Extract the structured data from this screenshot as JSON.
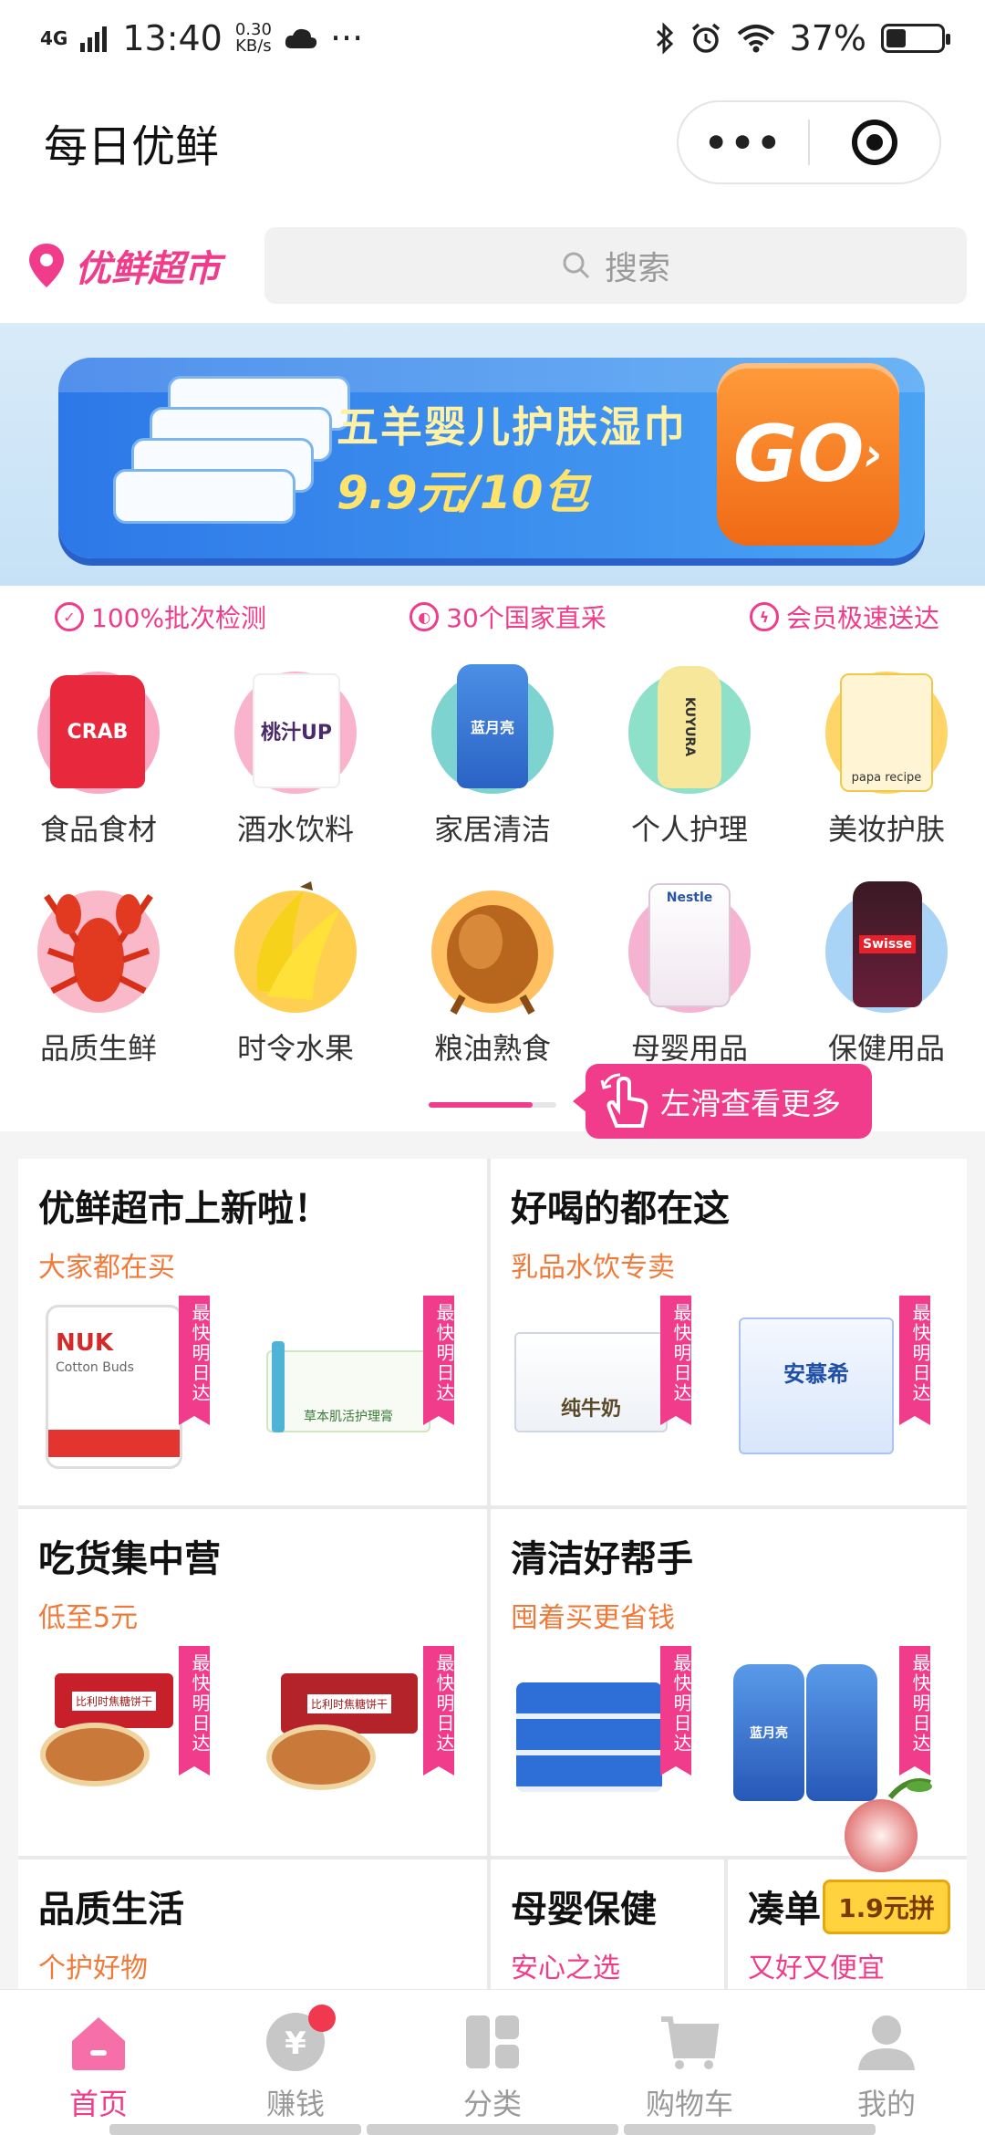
{
  "status_bar": {
    "network": "4G",
    "time": "13:40",
    "speed_value": "0.30",
    "speed_unit": "KB/s",
    "more": "···",
    "battery": "37%",
    "battery_level": 0.37
  },
  "title_bar": {
    "title": "每日优鲜",
    "more_label": "•••"
  },
  "search": {
    "store_name": "优鲜超市",
    "placeholder": "搜索"
  },
  "banner": {
    "headline": "五羊婴儿护肤湿巾",
    "price": "9.9元/10包",
    "go": "GO"
  },
  "features": [
    {
      "label": "100%批次检测",
      "icon": "shield-check-icon"
    },
    {
      "label": "30个国家直采",
      "icon": "globe-icon"
    },
    {
      "label": "会员极速送达",
      "icon": "lightning-icon"
    }
  ],
  "categories_row1": [
    {
      "label": "食品食材",
      "bg": "#f9a9c4",
      "img_text": "CRAB"
    },
    {
      "label": "酒水饮料",
      "bg": "#f9b3cc",
      "img_text": "桃汁UP"
    },
    {
      "label": "家居清洁",
      "bg": "#7dd3cf",
      "img_text": "蓝月亮"
    },
    {
      "label": "个人护理",
      "bg": "#8fe0c9",
      "img_text": "KUYURA"
    },
    {
      "label": "美妆护肤",
      "bg": "#ffd56a",
      "img_text": "papa recipe"
    }
  ],
  "categories_row2": [
    {
      "label": "品质生鲜",
      "bg": "#f9b9c8"
    },
    {
      "label": "时令水果",
      "bg": "#ffcf52"
    },
    {
      "label": "粮油熟食",
      "bg": "#ffc062"
    },
    {
      "label": "母婴用品",
      "bg": "#f6b3d1",
      "img_text": "Nestle"
    },
    {
      "label": "保健用品",
      "bg": "#a9d4f5",
      "img_text": "Swisse"
    }
  ],
  "swipe_tip": "左滑查看更多",
  "promos": {
    "p1": {
      "title": "优鲜超市上新啦！",
      "subtitle": "大家都在买",
      "a_text": "NUK",
      "a_sub": "Cotton Buds",
      "b_text": "草本肌活护理膏"
    },
    "p2": {
      "title": "好喝的都在这",
      "subtitle": "乳品水饮专卖",
      "a_text": "纯牛奶",
      "b_text": "安慕希"
    },
    "p3": {
      "title": "吃货集中营",
      "subtitle": "低至5元",
      "a_text": "比利时焦糖饼干",
      "b_text": "比利时焦糖饼干"
    },
    "p4": {
      "title": "清洁好帮手",
      "subtitle": "囤着买更省钱",
      "b_text": "蓝月亮"
    },
    "p5": {
      "title": "品质生活",
      "subtitle": "个护好物"
    },
    "p6": {
      "title": "母婴保健",
      "subtitle": "安心之选"
    },
    "p7": {
      "title": "凑单",
      "subtitle": "又好又便宜"
    },
    "fast_tag": "最快明日达"
  },
  "float_badge": "1.9元拼",
  "bottom_nav": [
    {
      "label": "首页",
      "icon": "home-icon",
      "active": true
    },
    {
      "label": "赚钱",
      "icon": "yen-coin-icon",
      "badge": true
    },
    {
      "label": "分类",
      "icon": "category-grid-icon"
    },
    {
      "label": "购物车",
      "icon": "cart-icon"
    },
    {
      "label": "我的",
      "icon": "user-icon"
    }
  ],
  "colors": {
    "accent": "#f03c8a",
    "orange": "#f07a3a"
  }
}
